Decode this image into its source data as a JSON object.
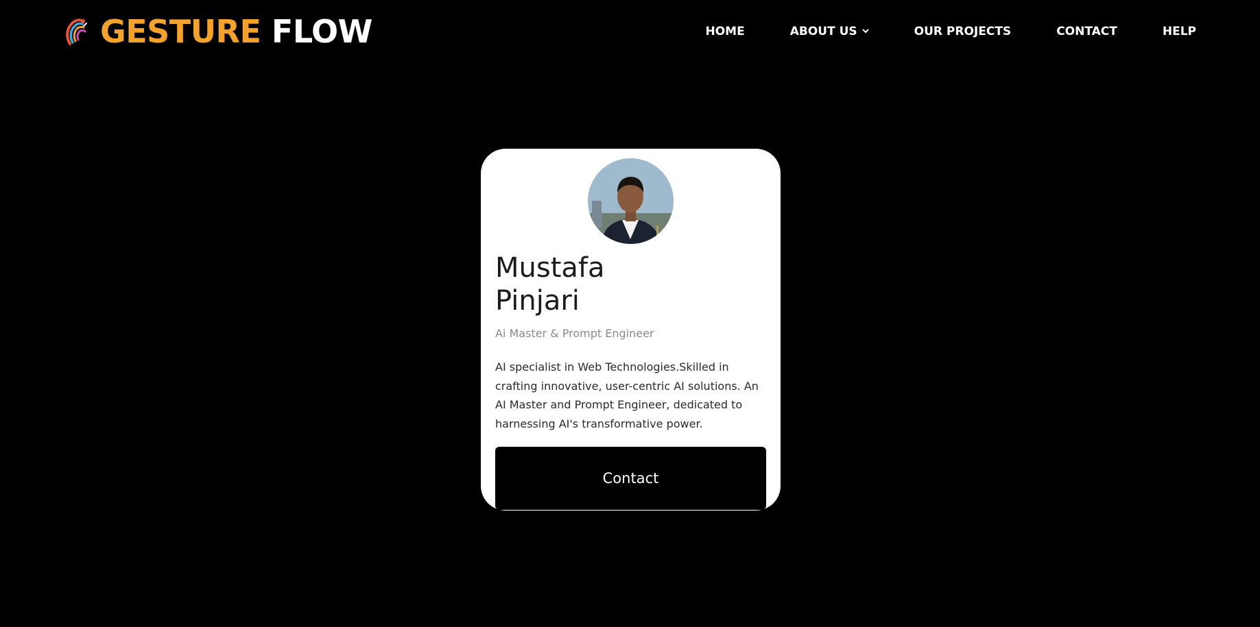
{
  "brand": {
    "accent_word": "GESTURE",
    "main_word": "FLOW",
    "logo_icon": "hand-gesture-logo-icon",
    "accent_color": "#F4A22E"
  },
  "nav": {
    "items": [
      {
        "label": "HOME"
      },
      {
        "label": "ABOUT US",
        "has_dropdown": true
      },
      {
        "label": "OUR PROJECTS"
      },
      {
        "label": "CONTACT"
      },
      {
        "label": "HELP"
      }
    ]
  },
  "profile": {
    "name": "Mustafa Pinjari",
    "role": "Ai Master & Prompt Engineer",
    "bio": "AI specialist in Web Technologies.Skilled in crafting innovative, user-centric AI solutions. An AI Master and Prompt Engineer, dedicated to harnessing AI's transformative power.",
    "contact_label": "Contact"
  },
  "colors": {
    "background": "#000000",
    "card": "#FFFFFF",
    "button": "#000000"
  }
}
